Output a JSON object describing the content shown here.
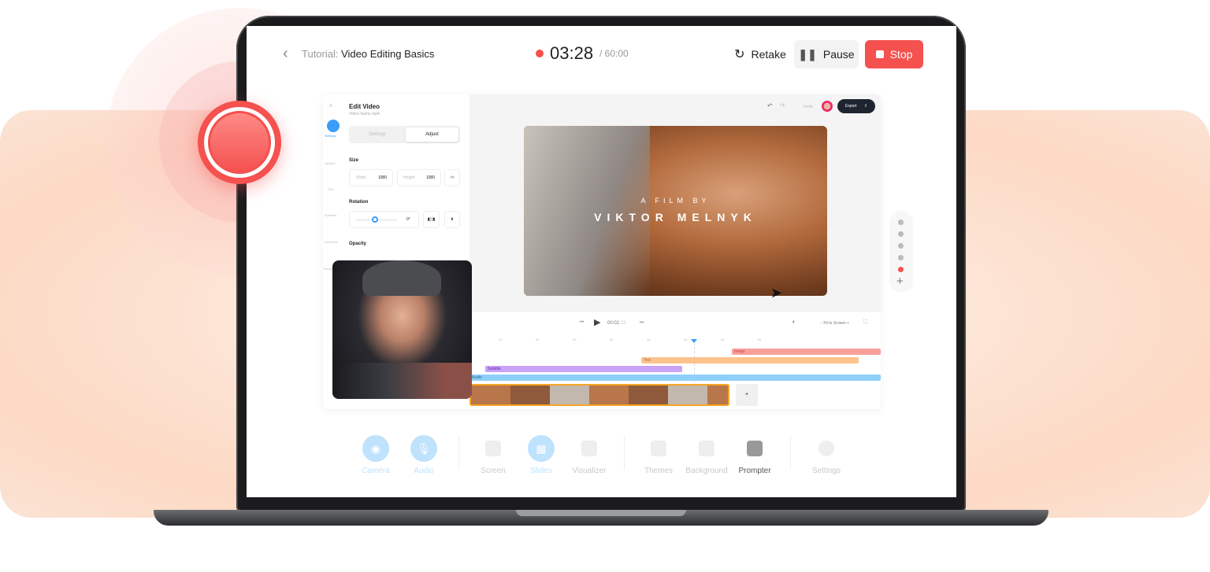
{
  "header": {
    "title_prefix": "Tutorial:",
    "title": "Video Editing Basics",
    "timer": "03:28",
    "timer_limit": "/ 60:00",
    "retake": "Retake",
    "pause": "Pause",
    "stop": "Stop"
  },
  "colors": {
    "accent_red": "#f4514f",
    "accent_blue": "#3a9df7",
    "peach": "#fde3d5"
  },
  "editor": {
    "panel_title": "Edit Video",
    "file_name": "Video-Name.mp4",
    "tabs": [
      "Settings",
      "Adjust"
    ],
    "active_tab": "Adjust",
    "size_label": "Size",
    "width_label": "Width",
    "width_value": "1080",
    "height_label": "Height",
    "height_value": "1080",
    "rotation_label": "Rotation",
    "rotation_value": "0°",
    "opacity_label": "Opacity",
    "sidebar": [
      "Settings",
      "Upload",
      "Text",
      "Subtitles",
      "Elements",
      "Transitions"
    ],
    "top": {
      "invite": "Invite",
      "export": "Export"
    },
    "video_title_small": "A FILM BY",
    "video_title_big": "VIKTOR MELNYK",
    "playback_time": "00:02",
    "playback_frames": ":23",
    "fit": "Fit to Screen",
    "ruler": [
      "20",
      "25",
      "30",
      "35",
      "40",
      "45",
      "50",
      "55"
    ],
    "tracks": {
      "image": "Image",
      "text": "Text",
      "subtitle": "Subtitle",
      "audio": "Audio"
    }
  },
  "toolbar": [
    {
      "label": "Camera",
      "icon": "camera-icon",
      "active": true
    },
    {
      "label": "Audio",
      "icon": "microphone-icon",
      "active": true
    },
    {
      "label": "Screen",
      "icon": "screen-share-icon",
      "active": false
    },
    {
      "label": "Slides",
      "icon": "slides-icon",
      "active": true
    },
    {
      "label": "Visualizer",
      "icon": "waveform-icon",
      "active": false
    },
    {
      "label": "Themes",
      "icon": "themes-icon",
      "active": false
    },
    {
      "label": "Background",
      "icon": "image-icon",
      "active": false
    },
    {
      "label": "Prompter",
      "icon": "prompter-icon",
      "active": false,
      "highlight": true
    },
    {
      "label": "Settings",
      "icon": "gear-icon",
      "active": false
    }
  ]
}
